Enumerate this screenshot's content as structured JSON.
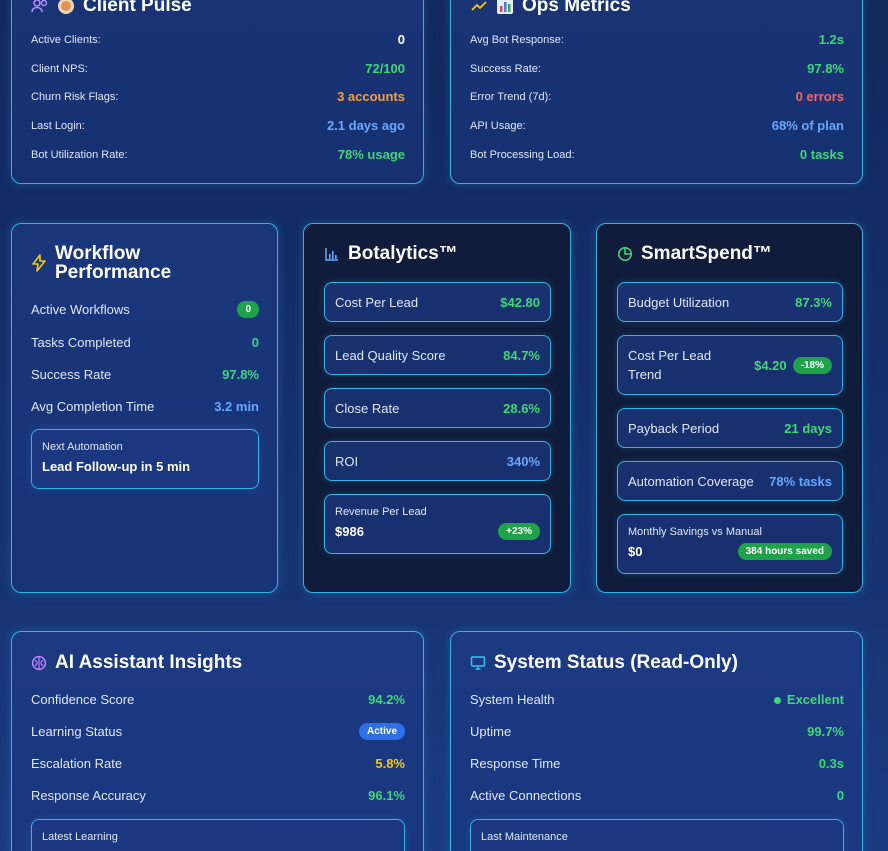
{
  "client_pulse": {
    "title": "Client Pulse",
    "rows": [
      {
        "label": "Active Clients:",
        "value": "0"
      },
      {
        "label": "Client NPS:",
        "value": "72/100"
      },
      {
        "label": "Churn Risk Flags:",
        "value": "3 accounts"
      },
      {
        "label": "Last Login:",
        "value": "2.1 days ago"
      },
      {
        "label": "Bot Utilization Rate:",
        "value": "78% usage"
      }
    ]
  },
  "ops_metrics": {
    "title": "Ops Metrics",
    "rows": [
      {
        "label": "Avg Bot Response:",
        "value": "1.2s"
      },
      {
        "label": "Success Rate:",
        "value": "97.8%"
      },
      {
        "label": "Error Trend (7d):",
        "value": "0 errors"
      },
      {
        "label": "API Usage:",
        "value": "68% of plan"
      },
      {
        "label": "Bot Processing Load:",
        "value": "0 tasks"
      }
    ]
  },
  "workflow": {
    "title_line1": "Workflow",
    "title_line2": "Performance",
    "rows": [
      {
        "label": "Active Workflows",
        "value": "0"
      },
      {
        "label": "Tasks Completed",
        "value": "0"
      },
      {
        "label": "Success Rate",
        "value": "97.8%"
      },
      {
        "label": "Avg Completion Time",
        "value": "3.2 min"
      }
    ],
    "next_caption": "Next Automation",
    "next_value": "Lead Follow-up in 5 min"
  },
  "botalytics": {
    "title": "Botalytics™",
    "rows": [
      {
        "label": "Cost Per Lead",
        "value": "$42.80"
      },
      {
        "label": "Lead Quality Score",
        "value": "84.7%"
      },
      {
        "label": "Close Rate",
        "value": "28.6%"
      },
      {
        "label": "ROI",
        "value": "340%"
      }
    ],
    "revenue_caption": "Revenue Per Lead",
    "revenue_value": "$986",
    "revenue_badge": "+23%"
  },
  "smartspend": {
    "title": "SmartSpend™",
    "budget_label": "Budget Utilization",
    "budget_value": "87.3%",
    "cpl_trend_line1": "Cost Per Lead",
    "cpl_trend_line2": "Trend",
    "cpl_trend_value": "$4.20",
    "cpl_trend_badge": "-18%",
    "payback_label": "Payback Period",
    "payback_value": "21 days",
    "coverage_label": "Automation Coverage",
    "coverage_value": "78% tasks",
    "savings_caption": "Monthly Savings vs Manual",
    "savings_value": "$0",
    "savings_badge": "384 hours saved"
  },
  "ai_insights": {
    "title": "AI Assistant Insights",
    "rows": [
      {
        "label": "Confidence Score",
        "value": "94.2%"
      },
      {
        "label": "Learning Status",
        "value": "Active"
      },
      {
        "label": "Escalation Rate",
        "value": "5.8%"
      },
      {
        "label": "Response Accuracy",
        "value": "96.1%"
      }
    ],
    "latest_caption": "Latest Learning"
  },
  "system_status": {
    "title": "System Status (Read-Only)",
    "rows": [
      {
        "label": "System Health",
        "value": "Excellent"
      },
      {
        "label": "Uptime",
        "value": "99.7%"
      },
      {
        "label": "Response Time",
        "value": "0.3s"
      },
      {
        "label": "Active Connections",
        "value": "0"
      }
    ],
    "maint_caption": "Last Maintenance"
  },
  "colors": {
    "border": "#2fb4e6",
    "green": "#3fd67a",
    "orange": "#f59e3b",
    "red": "#f56565",
    "blue": "#64a8ff",
    "yellow": "#f5c518"
  },
  "icons": {
    "client_pulse": "users-icon",
    "ops_metrics": "bar-chart-icon",
    "workflow": "lightning-icon",
    "botalytics": "column-chart-icon",
    "smartspend": "pie-chart-icon",
    "ai_insights": "brain-icon",
    "system_status": "monitor-icon"
  }
}
